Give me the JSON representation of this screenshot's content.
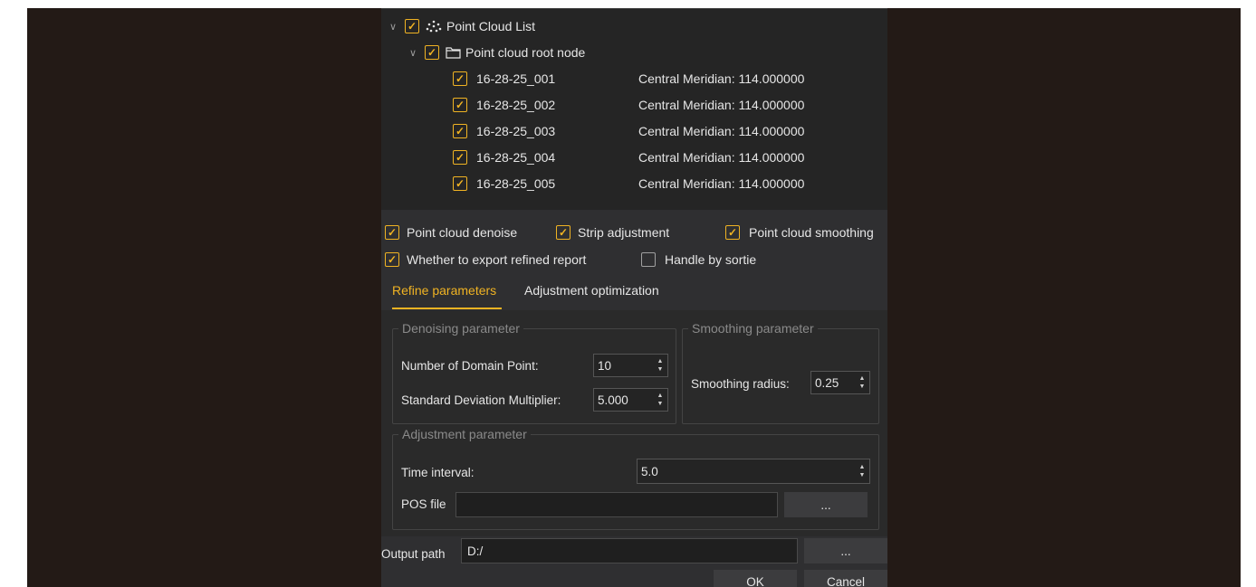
{
  "tree": {
    "root_label": "Point Cloud List",
    "node_label": "Point cloud root node",
    "items": [
      {
        "name": "16-28-25_001",
        "meta": "Central Meridian: 114.000000"
      },
      {
        "name": "16-28-25_002",
        "meta": "Central Meridian: 114.000000"
      },
      {
        "name": "16-28-25_003",
        "meta": "Central Meridian: 114.000000"
      },
      {
        "name": "16-28-25_004",
        "meta": "Central Meridian: 114.000000"
      },
      {
        "name": "16-28-25_005",
        "meta": "Central Meridian: 114.000000"
      }
    ]
  },
  "options": {
    "denoise": {
      "label": "Point cloud denoise",
      "checked": true
    },
    "strip": {
      "label": "Strip adjustment",
      "checked": true
    },
    "smoothing": {
      "label": "Point cloud smoothing",
      "checked": true
    },
    "export_report": {
      "label": "Whether to export refined report",
      "checked": true
    },
    "sortie": {
      "label": "Handle by sortie",
      "checked": false
    }
  },
  "tabs": [
    {
      "label": "Refine parameters",
      "active": true
    },
    {
      "label": "Adjustment optimization",
      "active": false
    }
  ],
  "denoising": {
    "title": "Denoising parameter",
    "domain_point_label": "Number of Domain Point:",
    "domain_point_value": "10",
    "std_dev_label": "Standard Deviation Multiplier:",
    "std_dev_value": "5.000"
  },
  "smoothing": {
    "title": "Smoothing parameter",
    "radius_label": "Smoothing radius:",
    "radius_value": "0.25"
  },
  "adjustment": {
    "title": "Adjustment parameter",
    "time_interval_label": "Time interval:",
    "time_interval_value": "5.0",
    "pos_file_label": "POS file",
    "pos_file_value": "",
    "browse_label": "..."
  },
  "output": {
    "label": "Output path",
    "value": "D:/",
    "browse_label": "..."
  },
  "buttons": {
    "ok": "OK",
    "cancel": "Cancel"
  },
  "colors": {
    "accent": "#f0b323",
    "backdrop": "#231a16",
    "dialog": "#2f2f31",
    "tree_bg": "#252525"
  }
}
